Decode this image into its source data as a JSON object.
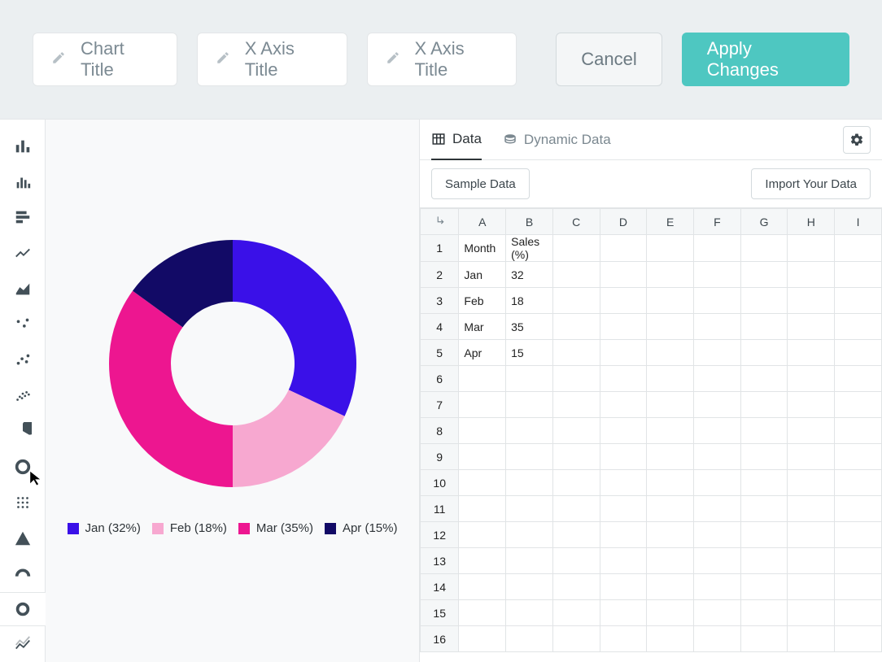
{
  "toolbar": {
    "chart_title": "Chart Title",
    "x_axis_title_1": "X Axis Title",
    "x_axis_title_2": "X Axis Title",
    "cancel": "Cancel",
    "apply": "Apply Changes"
  },
  "rail": [
    {
      "name": "bar-chart-icon"
    },
    {
      "name": "column-chart-icon"
    },
    {
      "name": "horizontal-bar-icon"
    },
    {
      "name": "line-chart-icon"
    },
    {
      "name": "area-chart-icon"
    },
    {
      "name": "scatter-dots-icon"
    },
    {
      "name": "bubble-chart-icon"
    },
    {
      "name": "scatter-dense-icon"
    },
    {
      "name": "pie-chart-icon"
    },
    {
      "name": "donut-chart-icon"
    },
    {
      "name": "grid-matrix-icon"
    },
    {
      "name": "pyramid-chart-icon"
    },
    {
      "name": "gauge-chart-icon"
    },
    {
      "name": "ring-chart-icon",
      "selected": true
    },
    {
      "name": "candlestick-icon"
    }
  ],
  "tabs": {
    "data": "Data",
    "dynamic": "Dynamic Data"
  },
  "actions": {
    "sample": "Sample Data",
    "import": "Import Your Data"
  },
  "sheet": {
    "columns": [
      "A",
      "B",
      "C",
      "D",
      "E",
      "F",
      "G",
      "H",
      "I"
    ],
    "row_count": 16,
    "cells": {
      "1": {
        "A": "Month",
        "B": "Sales (%)"
      },
      "2": {
        "A": "Jan",
        "B": "32"
      },
      "3": {
        "A": "Feb",
        "B": "18"
      },
      "4": {
        "A": "Mar",
        "B": "35"
      },
      "5": {
        "A": "Apr",
        "B": "15"
      }
    }
  },
  "chart_data": {
    "type": "pie",
    "title": "",
    "inner_radius_ratio": 0.5,
    "series": [
      {
        "label": "Jan",
        "value": 32,
        "color": "#3a10e8"
      },
      {
        "label": "Feb",
        "value": 18,
        "color": "#f7a8d0"
      },
      {
        "label": "Mar",
        "value": 35,
        "color": "#ed1690"
      },
      {
        "label": "Apr",
        "value": 15,
        "color": "#120a66"
      }
    ],
    "legend_format": "{label} ({value}%)"
  }
}
